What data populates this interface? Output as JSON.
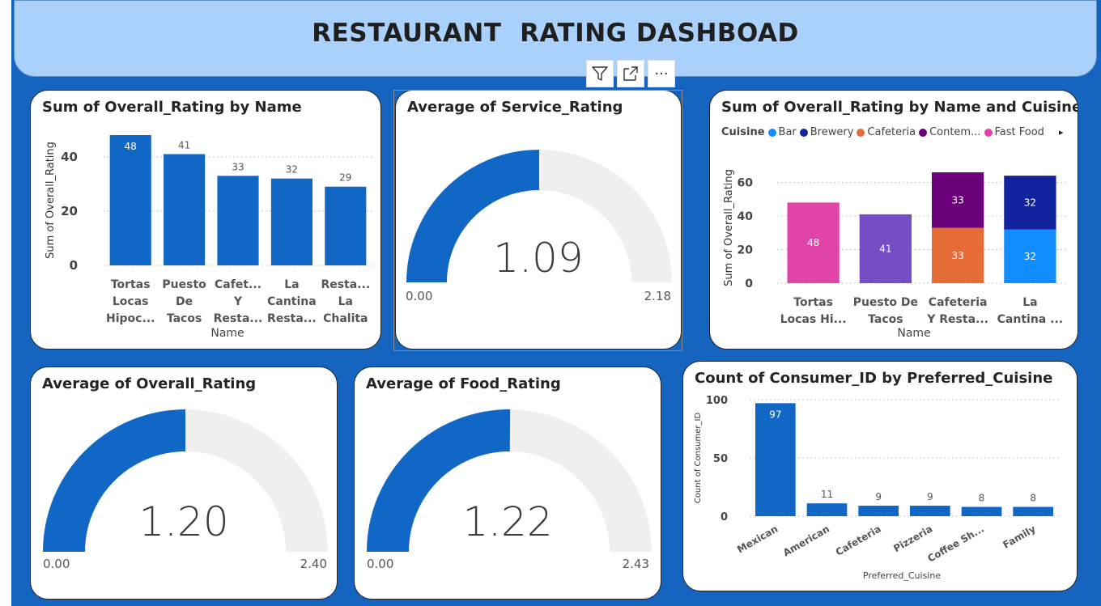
{
  "dashboard": {
    "title": "RESTAURANT  RATING DASHBOAD"
  },
  "visual_header": {
    "icons": [
      "filter-icon",
      "focus-mode-icon",
      "more-options-icon"
    ],
    "more_glyph": "···"
  },
  "colors": {
    "canvas": "#1565c0",
    "title_bg": "#a9d1fb",
    "bar": "#1167c6",
    "gauge_fill": "#1167c6",
    "gauge_track": "#f0efee",
    "bar_legend": "#118dff",
    "brewery": "#12239e",
    "cafeteria": "#e66c37",
    "contemporary": "#6b007b",
    "fast_food": "#e044a7",
    "purple": "#744ec2"
  },
  "cards": {
    "overall_by_name": {
      "title": "Sum of Overall_Rating by Name"
    },
    "service_gauge": {
      "title": "Average of Service_Rating"
    },
    "by_name_cuisine": {
      "title": "Sum of Overall_Rating by Name and Cuisine",
      "legend_title": "Cuisine",
      "legend": [
        {
          "label": "Bar",
          "color": "#118dff"
        },
        {
          "label": "Brewery",
          "color": "#12239e"
        },
        {
          "label": "Cafeteria",
          "color": "#e66c37"
        },
        {
          "label": "Contem...",
          "color": "#6b007b"
        },
        {
          "label": "Fast Food",
          "color": "#e044a7"
        }
      ],
      "legend_more": "▸"
    },
    "overall_gauge": {
      "title": "Average of Overall_Rating"
    },
    "food_gauge": {
      "title": "Average of Food_Rating"
    },
    "consumer_count": {
      "title": "Count of Consumer_ID by Preferred_Cuisine"
    }
  },
  "chart_data": [
    {
      "id": "overall_by_name",
      "type": "bar",
      "title": "Sum of Overall_Rating by Name",
      "xlabel": "Name",
      "ylabel": "Sum of Overall_Rating",
      "ylim": [
        0,
        48
      ],
      "yticks": [
        0,
        20,
        40
      ],
      "grid": true,
      "categories": [
        [
          "Tortas",
          "Locas",
          "Hipoc..."
        ],
        [
          "Puesto",
          "De",
          "Tacos"
        ],
        [
          "Cafet...",
          "Y",
          "Resta..."
        ],
        [
          "La",
          "Cantina",
          "Resta..."
        ],
        [
          "Resta...",
          "La",
          "Chalita"
        ]
      ],
      "values": [
        48,
        41,
        33,
        32,
        29
      ]
    },
    {
      "id": "service_gauge",
      "type": "gauge",
      "title": "Average of Service_Rating",
      "value": 1.09,
      "value_label": "1.09",
      "min": 0,
      "max": 2.18,
      "min_label": "0.00",
      "max_label": "2.18"
    },
    {
      "id": "by_name_cuisine",
      "type": "bar",
      "stacked": true,
      "title": "Sum of Overall_Rating by Name and Cuisine",
      "xlabel": "Name",
      "ylabel": "Sum of Overall_Rating",
      "ylim": [
        0,
        66
      ],
      "yticks": [
        0,
        20,
        40,
        60
      ],
      "grid": true,
      "categories": [
        [
          "Tortas",
          "Locas Hi..."
        ],
        [
          "Puesto De",
          "Tacos"
        ],
        [
          "Cafeteria",
          "Y Resta..."
        ],
        [
          "La",
          "Cantina ..."
        ]
      ],
      "segments": [
        [
          {
            "value": 48,
            "color": "#e044a7"
          }
        ],
        [
          {
            "value": 41,
            "color": "#744ec2"
          }
        ],
        [
          {
            "value": 33,
            "color": "#e66c37"
          },
          {
            "value": 33,
            "color": "#6b007b"
          }
        ],
        [
          {
            "value": 32,
            "color": "#118dff"
          },
          {
            "value": 32,
            "color": "#12239e"
          }
        ]
      ]
    },
    {
      "id": "overall_gauge",
      "type": "gauge",
      "title": "Average of Overall_Rating",
      "value": 1.2,
      "value_label": "1.20",
      "min": 0,
      "max": 2.4,
      "min_label": "0.00",
      "max_label": "2.40"
    },
    {
      "id": "food_gauge",
      "type": "gauge",
      "title": "Average of Food_Rating",
      "value": 1.22,
      "value_label": "1.22",
      "min": 0,
      "max": 2.43,
      "min_label": "0.00",
      "max_label": "2.43"
    },
    {
      "id": "consumer_count",
      "type": "bar",
      "title": "Count of Consumer_ID by Preferred_Cuisine",
      "xlabel": "Preferred_Cuisine",
      "ylabel": "Count of Consumer_ID",
      "ylim": [
        0,
        100
      ],
      "yticks": [
        0,
        50,
        100
      ],
      "grid": true,
      "categories": [
        "Mexican",
        "American",
        "Cafeteria",
        "Pizzeria",
        "Coffee Sh...",
        "Family"
      ],
      "values": [
        97,
        11,
        9,
        9,
        8,
        8
      ]
    }
  ]
}
